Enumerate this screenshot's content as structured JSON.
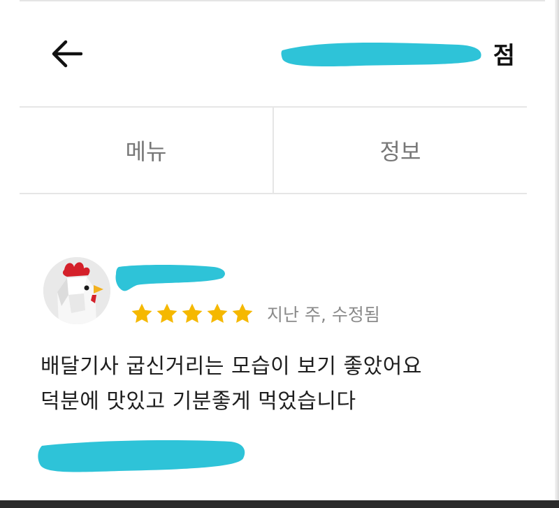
{
  "header": {
    "back_icon": "arrow-left-icon",
    "title_visible": "점"
  },
  "tabs": [
    {
      "label": "메뉴"
    },
    {
      "label": "정보"
    }
  ],
  "review": {
    "avatar": "chicken-avatar",
    "rating": 5,
    "rating_max": 5,
    "star_color": "#f5b800",
    "meta": "지난 주, 수정됨",
    "lines": [
      "배달기사 굽신거리는 모습이 보기 좋았어요",
      "덕분에 맛있고 기분좋게 먹었습니다"
    ]
  },
  "redaction_color": "#2ec3d8"
}
